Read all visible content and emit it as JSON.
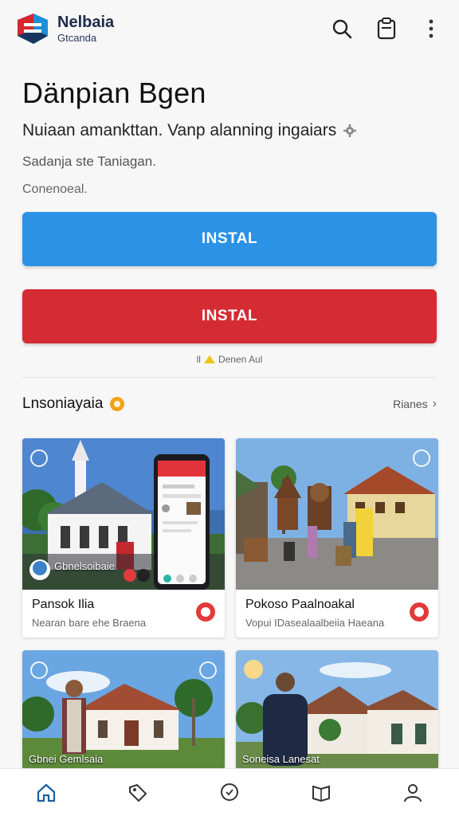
{
  "header": {
    "brand_name": "Nelbaia",
    "brand_sub": "Gtcanda",
    "icons": [
      "logo-icon",
      "search-icon",
      "clipboard-icon",
      "more-vertical-icon"
    ]
  },
  "hero": {
    "title": "Dänpian Bgen",
    "subtitle": "Nuiaan amankttan. Vanp alanning ingaiars",
    "meta_line1": "Sadanja ste Taniagan.",
    "meta_line2": "Conenoeal."
  },
  "buttons": {
    "install_primary": "INSTAL",
    "install_secondary": "INSTAL"
  },
  "note": {
    "prefix": "ll",
    "text": "Denen Aul"
  },
  "section": {
    "title": "Lnsoniayaia",
    "link": "Rianes"
  },
  "cards": [
    {
      "title": "Pansok Ilia",
      "subtitle": "Nearan bare ehe Braena",
      "overlay": "Gbnelsoibaie"
    },
    {
      "title": "Pokoso Paalnoakal",
      "subtitle": "Vopui IDasealaalbeiia Haeana",
      "overlay": ""
    },
    {
      "title": "",
      "subtitle": "",
      "overlay": "Gbnei Gemlsaia"
    },
    {
      "title": "",
      "subtitle": "",
      "overlay": "Soneisa Lanesat"
    }
  ],
  "colors": {
    "primary_blue": "#2b92e6",
    "danger_red": "#d52b33",
    "accent_orange": "#f2a21c"
  },
  "bottom_nav": [
    "home-icon",
    "tag-icon",
    "chat-icon",
    "book-icon",
    "profile-icon"
  ]
}
